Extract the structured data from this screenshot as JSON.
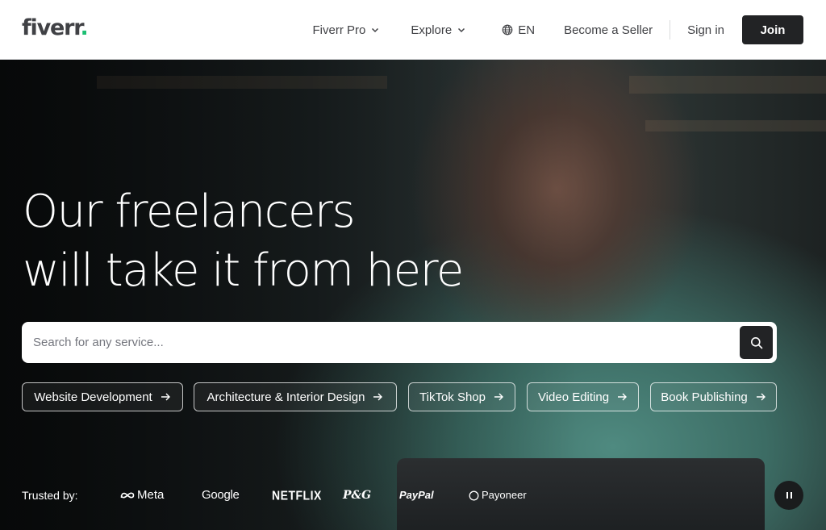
{
  "header": {
    "logo_text": "fiverr",
    "logo_dot": ".",
    "nav": {
      "fiverr_pro": "Fiverr Pro",
      "explore": "Explore",
      "language": "EN",
      "become_seller": "Become a Seller",
      "sign_in": "Sign in",
      "join": "Join"
    }
  },
  "hero": {
    "headline_line1": "Our freelancers",
    "headline_line2": "will take it from here",
    "search": {
      "placeholder": "Search for any service...",
      "value": ""
    },
    "chips": [
      {
        "label": "Website Development"
      },
      {
        "label": "Architecture & Interior Design"
      },
      {
        "label": "TikTok Shop"
      },
      {
        "label": "Video Editing"
      },
      {
        "label": "Book Publishing"
      }
    ],
    "trusted": {
      "label": "Trusted by:",
      "brands": [
        "Meta",
        "Google",
        "NETFLIX",
        "P&G",
        "PayPal",
        "Payoneer"
      ]
    }
  },
  "colors": {
    "brand_green": "#1dbf73",
    "dark": "#222325",
    "text": "#404145"
  }
}
